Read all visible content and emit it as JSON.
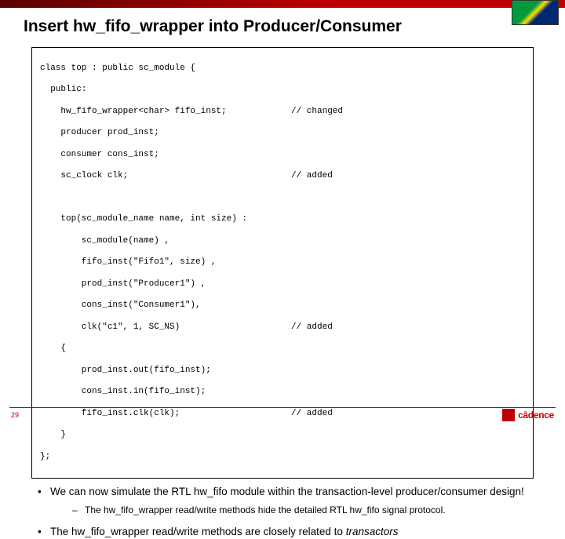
{
  "title": "Insert hw_fifo_wrapper into Producer/Consumer",
  "code": {
    "l0a": "class top : public sc_module {",
    "l1a": "  public:",
    "l2a": "    hw_fifo_wrapper<char> fifo_inst;",
    "l2b": "// changed",
    "l3a": "    producer prod_inst;",
    "l4a": "    consumer cons_inst;",
    "l5a": "    sc_clock clk;",
    "l5b": "// added",
    "blank1": " ",
    "l6a": "    top(sc_module_name name, int size) :",
    "l7a": "        sc_module(name) ,",
    "l8a": "        fifo_inst(\"Fifo1\", size) ,",
    "l9a": "        prod_inst(\"Producer1\") ,",
    "l10a": "        cons_inst(\"Consumer1\"),",
    "l11a": "        clk(\"c1\", 1, SC_NS)",
    "l11b": "// added",
    "l12a": "    {",
    "l13a": "        prod_inst.out(fifo_inst);",
    "l14a": "        cons_inst.in(fifo_inst);",
    "l15a": "        fifo_inst.clk(clk);",
    "l15b": "// added",
    "l16a": "    }",
    "l17a": "};"
  },
  "bullet1": "We can now simulate the RTL hw_fifo module within the transaction-level producer/consumer design!",
  "bullet2": "The hw_fifo_wrapper read/write methods hide the detailed RTL hw_fifo signal protocol.",
  "bullet3_pre": "The hw_fifo_wrapper read/write methods are closely related to ",
  "bullet3_em": "transactors",
  "page": "29",
  "brand": "cādence"
}
